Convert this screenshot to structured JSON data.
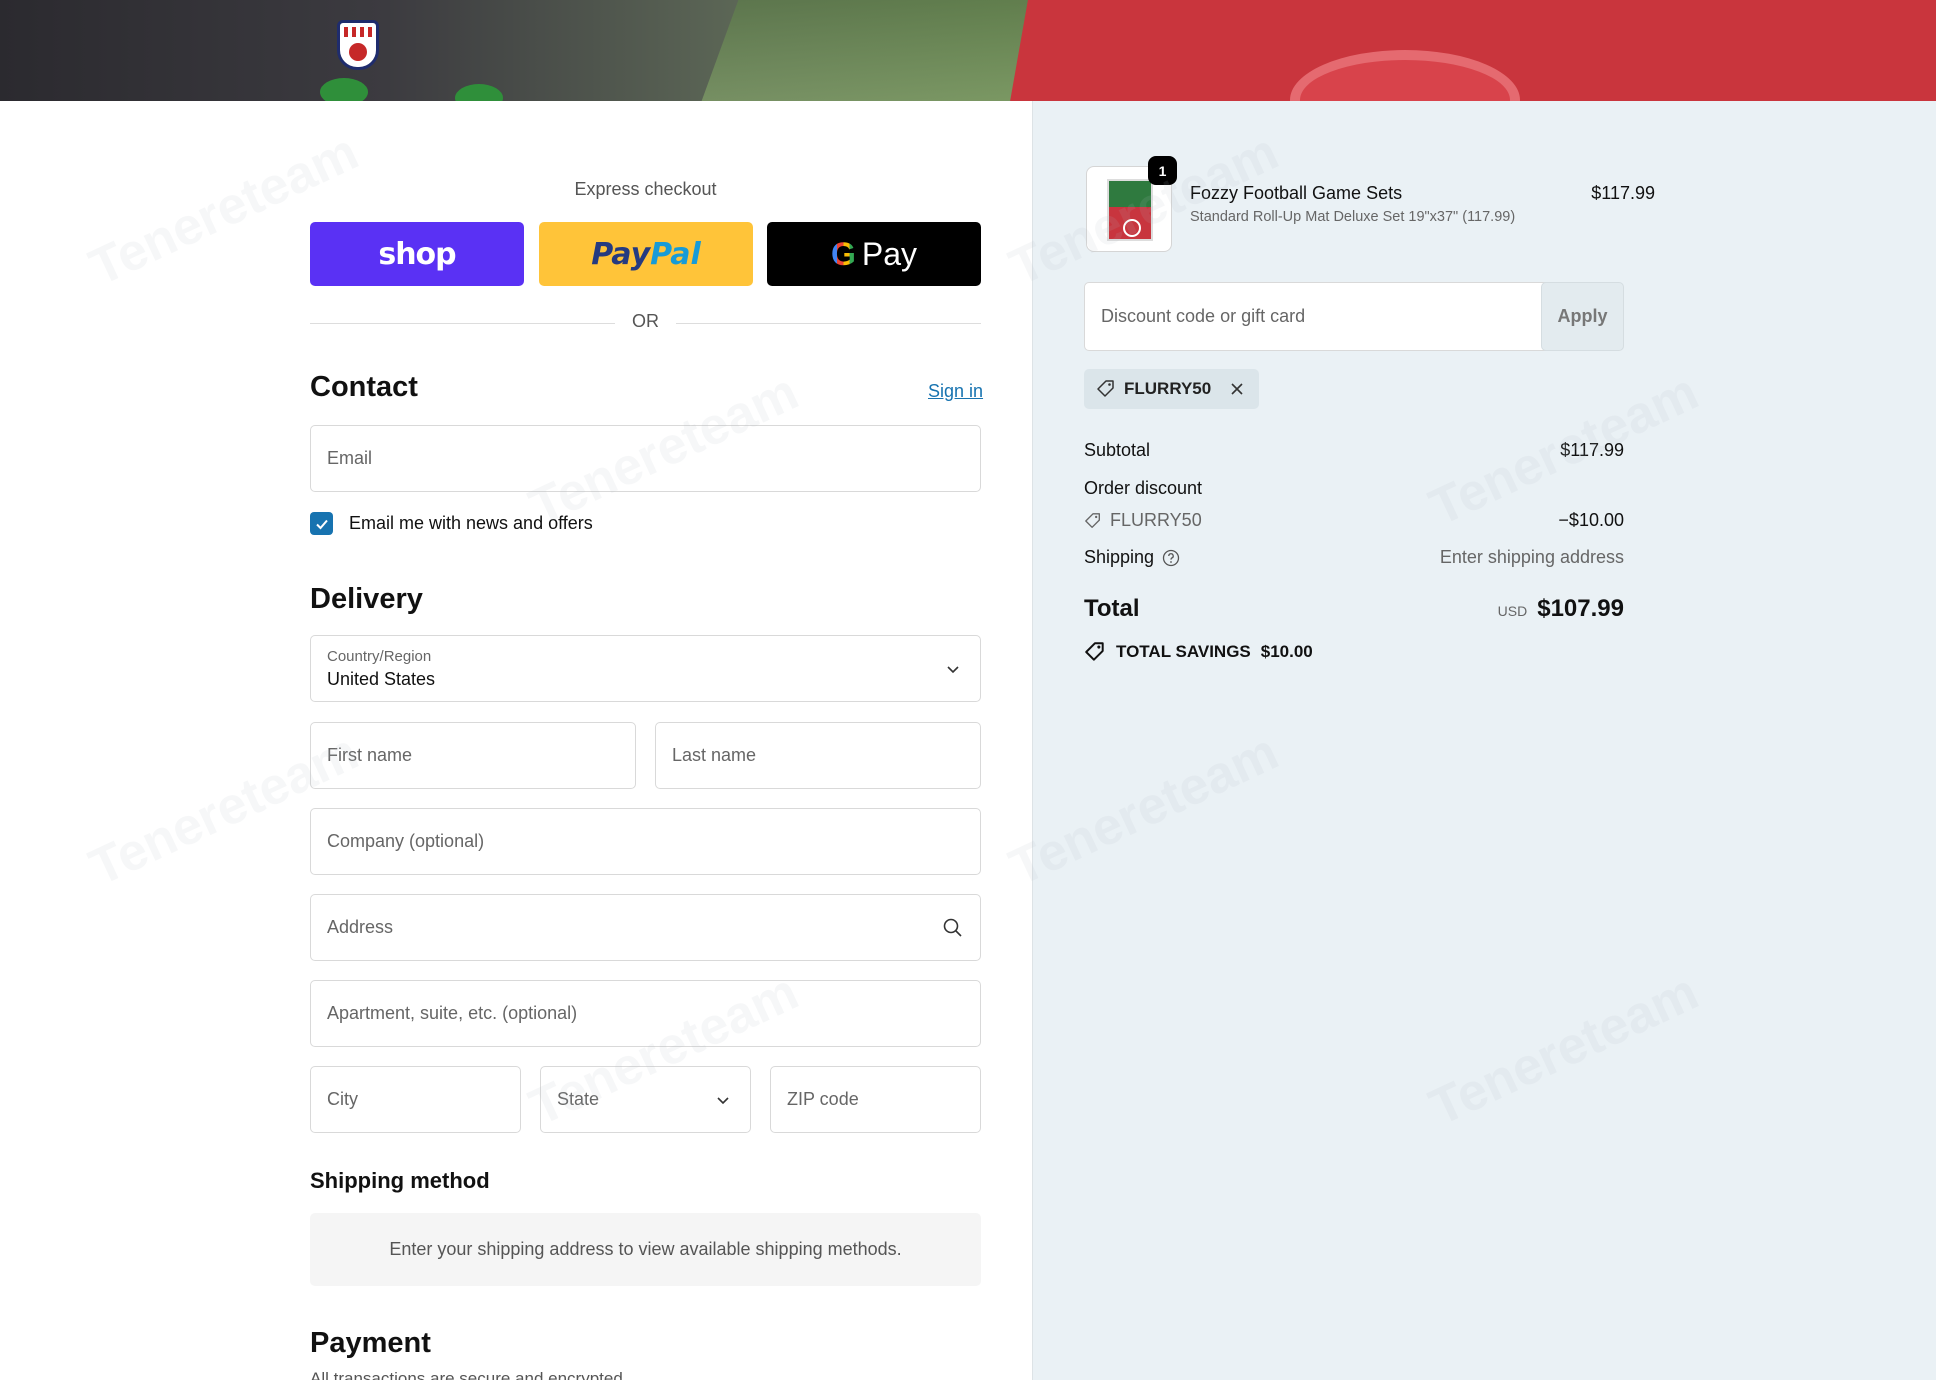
{
  "banner": {
    "logo_alt": "Fozzy"
  },
  "express": {
    "title": "Express checkout",
    "shop_label": "shop",
    "paypal_pay": "Pay",
    "paypal_pal": "Pal",
    "gpay_label": "Pay",
    "or_label": "OR"
  },
  "contact": {
    "title": "Contact",
    "sign_in": "Sign in",
    "email_placeholder": "Email",
    "newsletter_label": "Email me with news and offers",
    "newsletter_checked": true
  },
  "delivery": {
    "title": "Delivery",
    "country_label": "Country/Region",
    "country_value": "United States",
    "first_name_placeholder": "First name",
    "last_name_placeholder": "Last name",
    "company_placeholder": "Company (optional)",
    "address_placeholder": "Address",
    "apartment_placeholder": "Apartment, suite, etc. (optional)",
    "city_placeholder": "City",
    "state_label": "State",
    "zip_placeholder": "ZIP code"
  },
  "shipping_method": {
    "title": "Shipping method",
    "note": "Enter your shipping address to view available shipping methods."
  },
  "payment": {
    "title": "Payment",
    "note": "All transactions are secure and encrypted."
  },
  "summary": {
    "item": {
      "quantity": "1",
      "name": "Fozzy Football Game Sets",
      "variant": "Standard Roll-Up Mat Deluxe Set 19\"x37\" (117.99)",
      "price": "$117.99"
    },
    "discount_placeholder": "Discount code or gift card",
    "apply_label": "Apply",
    "applied_code": "FLURRY50",
    "subtotal_label": "Subtotal",
    "subtotal_value": "$117.99",
    "order_discount_label": "Order discount",
    "discount_code": "FLURRY50",
    "discount_value": "−$10.00",
    "shipping_label": "Shipping",
    "shipping_value": "Enter shipping address",
    "total_label": "Total",
    "currency": "USD",
    "total_value": "$107.99",
    "savings_label": "TOTAL SAVINGS",
    "savings_value": "$10.00"
  },
  "watermark": "Tenereteam",
  "colors": {
    "shop": "#5a31f4",
    "paypal": "#ffc439",
    "gpay": "#000000",
    "link": "#1773b0",
    "summary_bg": "#eaf1f5"
  }
}
